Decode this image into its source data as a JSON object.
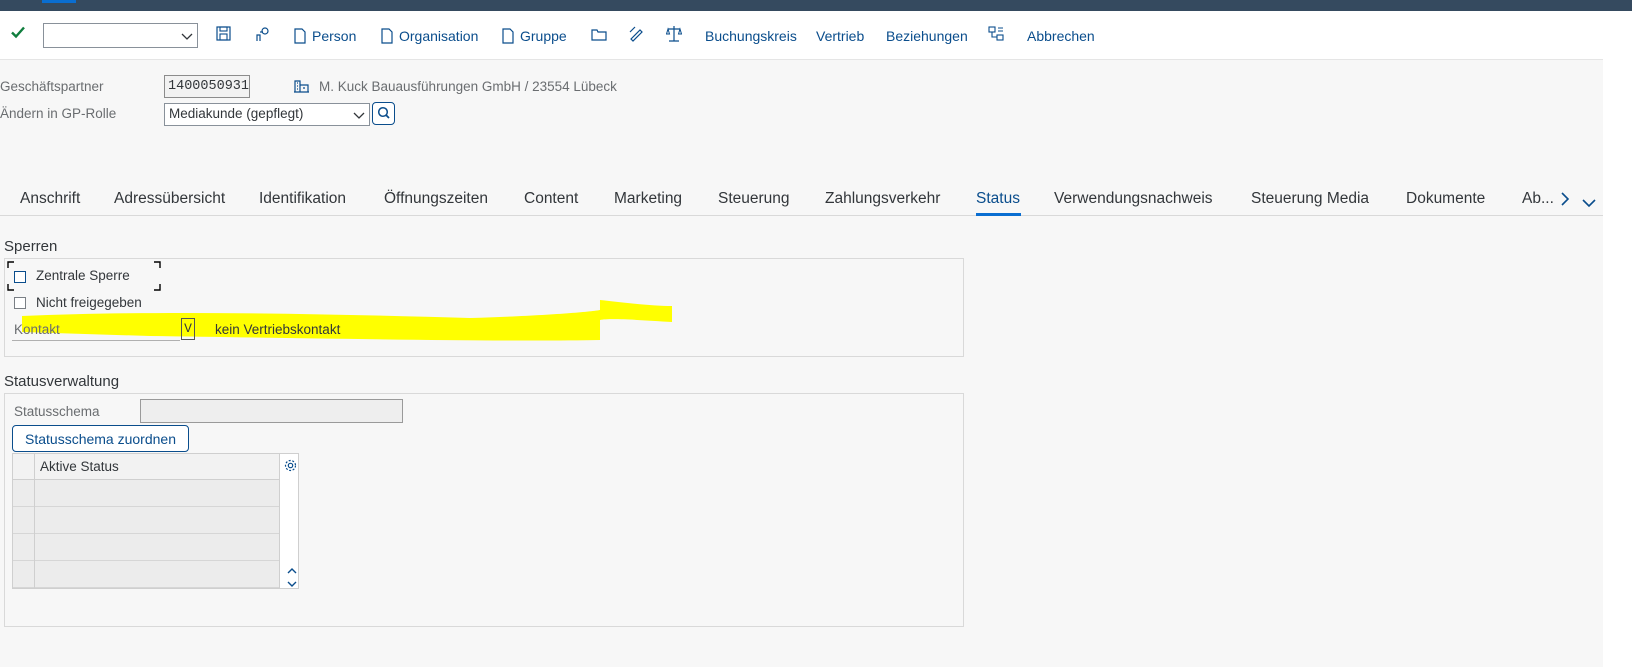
{
  "toolbar": {
    "person": "Person",
    "organisation": "Organisation",
    "gruppe": "Gruppe",
    "buchungskreis": "Buchungskreis",
    "vertrieb": "Vertrieb",
    "beziehungen": "Beziehungen",
    "abbrechen": "Abbrechen",
    "command_value": ""
  },
  "header": {
    "partner_label": "Geschäftspartner",
    "partner_number": "1400050931",
    "partner_description": "M. Kuck Bauausführungen GmbH / 23554 Lübeck",
    "role_label": "Ändern in GP-Rolle",
    "role_value": "Mediakunde (gepflegt)"
  },
  "tabs": [
    {
      "label": "Anschrift"
    },
    {
      "label": "Adressübersicht"
    },
    {
      "label": "Identifikation"
    },
    {
      "label": "Öffnungszeiten"
    },
    {
      "label": "Content"
    },
    {
      "label": "Marketing"
    },
    {
      "label": "Steuerung"
    },
    {
      "label": "Zahlungsverkehr"
    },
    {
      "label": "Status",
      "active": true
    },
    {
      "label": "Verwendungsnachweis"
    },
    {
      "label": "Steuerung Media"
    },
    {
      "label": "Dokumente"
    },
    {
      "label": "Ab..."
    }
  ],
  "sperren": {
    "title": "Sperren",
    "zentrale_sperre": "Zentrale Sperre",
    "nicht_freigegeben": "Nicht freigegeben",
    "kontakt_label": "Kontakt",
    "kontakt_value": "V",
    "kontakt_text": "kein Vertriebskontakt",
    "highlight_color": "#ffff00"
  },
  "statusverwaltung": {
    "title": "Statusverwaltung",
    "schema_label": "Statusschema",
    "schema_value": "",
    "assign_button": "Statusschema zuordnen",
    "table_header": "Aktive Status"
  },
  "colors": {
    "shell": "#354a5f",
    "link": "#0a4d8c",
    "accept": "#107e3e"
  }
}
